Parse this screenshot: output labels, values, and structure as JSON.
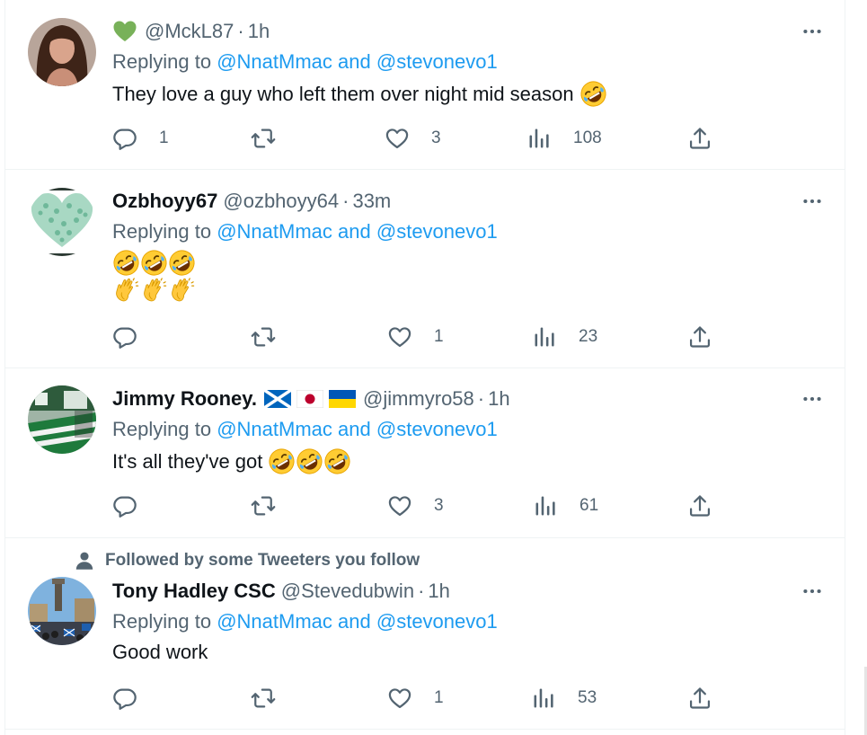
{
  "colors": {
    "accent": "#1d9bf0",
    "secondary_text": "#536471",
    "primary_text": "#0f1419",
    "border": "#eff3f4"
  },
  "reply_prefix": "Replying to",
  "mentions": {
    "first": "@NnatMmac",
    "joiner": "and",
    "second": "@stevonevo1"
  },
  "tweets": [
    {
      "display_name": "",
      "name_icon": "green-heart-emoji",
      "handle": "@MckL87",
      "separator": "·",
      "time": "1h",
      "text": "They love a guy who left them over night mid season",
      "text_emoji": [
        "rofl"
      ],
      "replies": "1",
      "retweets": "",
      "likes": "3",
      "views": "108"
    },
    {
      "display_name": "Ozbhoyy67",
      "handle": "@ozbhoyy64",
      "separator": "·",
      "time": "33m",
      "text": "",
      "text_emoji_rows": [
        [
          "rofl",
          "rofl",
          "rofl"
        ],
        [
          "clap",
          "clap",
          "clap"
        ]
      ],
      "replies": "",
      "retweets": "",
      "likes": "1",
      "views": "23"
    },
    {
      "display_name": "Jimmy Rooney.",
      "name_flags": [
        "scotland-flag",
        "japan-flag",
        "ukraine-flag"
      ],
      "handle": "@jimmyro58",
      "separator": "·",
      "time": "1h",
      "text": "It's all they've got",
      "text_emoji": [
        "rofl",
        "rofl",
        "rofl"
      ],
      "replies": "",
      "retweets": "",
      "likes": "3",
      "views": "61"
    },
    {
      "social_context": "Followed by some Tweeters you follow",
      "display_name": "Tony Hadley CSC",
      "handle": "@Stevedubwin",
      "separator": "·",
      "time": "1h",
      "text": "Good work",
      "replies": "",
      "retweets": "",
      "likes": "1",
      "views": "53"
    }
  ]
}
